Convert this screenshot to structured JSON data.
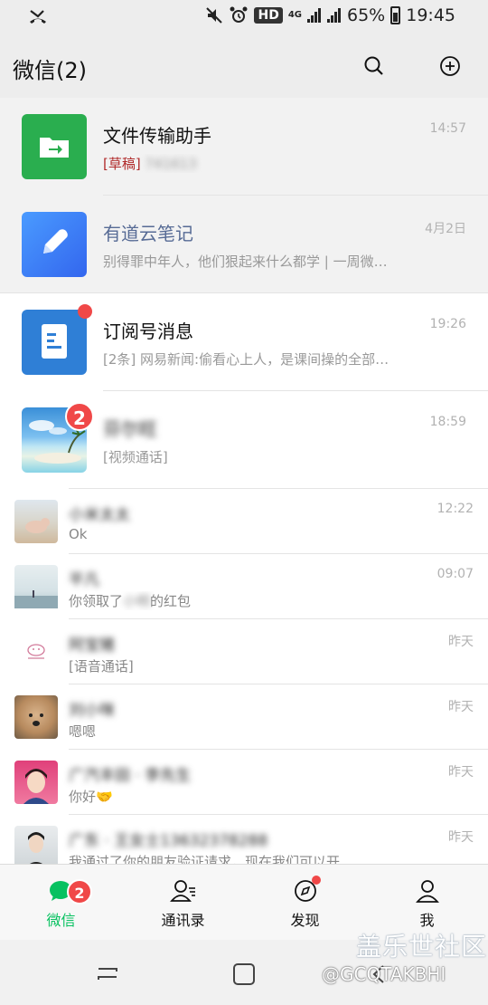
{
  "status_bar": {
    "hd": "HD",
    "network": "4G",
    "battery_percent": "65%",
    "time": "19:45"
  },
  "header": {
    "title": "微信(2)",
    "icons": [
      "search-icon",
      "add-circle-icon"
    ]
  },
  "chats": [
    {
      "name": "文件传输助手",
      "preview_tag": "[草稿]",
      "preview": "741613",
      "time": "14:57",
      "pinned": true,
      "avatar": "file-transfer-icon",
      "avatar_color": "#2aae4f"
    },
    {
      "name": "有道云笔记",
      "preview": "别得罪中年人，他们狠起来什么都学 | 一周微…",
      "time": "4月2日",
      "pinned": true,
      "avatar": "youdao-note-icon",
      "avatar_color": "#3d7cf5",
      "name_color": "#576b95"
    },
    {
      "name": "订阅号消息",
      "preview": "[2条] 网易新闻:偷看心上人，是课间操的全部…",
      "time": "19:26",
      "pinned": false,
      "avatar": "subscription-icon",
      "avatar_color": "#2f7fd6",
      "dot": true
    },
    {
      "name": "芬尔旺",
      "preview": "[视频通话]",
      "time": "18:59",
      "pinned": false,
      "avatar": "beach-photo",
      "unread": "2"
    },
    {
      "name": "小米太太",
      "preview": "Ok",
      "time": "12:22",
      "avatar": "pig-photo"
    },
    {
      "name": "平凡",
      "preview_parts": [
        "你领取了",
        "小明",
        "的红包"
      ],
      "time": "09:07",
      "avatar": "sea-photo"
    },
    {
      "name": "阿宝猪",
      "preview": "[语音通话]",
      "time": "昨天",
      "avatar": "pink-pig-logo"
    },
    {
      "name": "刘小咪",
      "preview": "嗯嗯",
      "time": "昨天",
      "avatar": "dog-photo"
    },
    {
      "name": "广汽丰田 · 李先生",
      "preview": "你好🤝",
      "time": "昨天",
      "avatar": "girl-cartoon"
    },
    {
      "name": "广东 · 王女士13632378288",
      "preview": "我通过了你的朋友验证请求，现在我们可以开…",
      "time": "昨天",
      "avatar": "woman-photo"
    }
  ],
  "tabs": [
    {
      "label": "微信",
      "icon": "chat-bubble-icon",
      "active": true,
      "badge": "2"
    },
    {
      "label": "通讯录",
      "icon": "contacts-icon",
      "active": false
    },
    {
      "label": "发现",
      "icon": "compass-icon",
      "active": false,
      "dot": true
    },
    {
      "label": "我",
      "icon": "person-icon",
      "active": false
    }
  ],
  "watermark": {
    "line1": "盖乐世社区",
    "line2": "@GCQTAKBHI"
  },
  "colors": {
    "wechat_green": "#07c160",
    "badge_red": "#f04848",
    "background": "#ededed"
  }
}
